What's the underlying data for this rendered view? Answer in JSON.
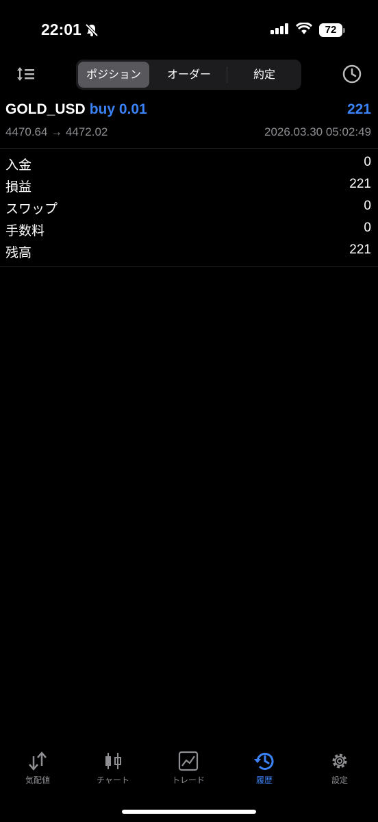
{
  "status_bar": {
    "time": "22:01",
    "battery": "72"
  },
  "tabs": [
    {
      "label": "ポジション",
      "active": true
    },
    {
      "label": "オーダー",
      "active": false
    },
    {
      "label": "約定",
      "active": false
    }
  ],
  "position": {
    "symbol": "GOLD_USD",
    "side": "buy 0.01",
    "profit": "221",
    "prices": "4470.64 → 4472.02",
    "datetime": "2026.03.30 05:02:49"
  },
  "summary": [
    {
      "label": "入金",
      "value": "0"
    },
    {
      "label": "損益",
      "value": "221"
    },
    {
      "label": "スワップ",
      "value": "0"
    },
    {
      "label": "手数料",
      "value": "0"
    },
    {
      "label": "残高",
      "value": "221"
    }
  ],
  "nav": [
    {
      "label": "気配値",
      "icon": "quotes-arrows-icon",
      "active": false
    },
    {
      "label": "チャート",
      "icon": "candlestick-icon",
      "active": false
    },
    {
      "label": "トレード",
      "icon": "trade-chart-icon",
      "active": false
    },
    {
      "label": "履歴",
      "icon": "history-icon",
      "active": true
    },
    {
      "label": "設定",
      "icon": "settings-gear-icon",
      "active": false
    }
  ],
  "colors": {
    "accent": "#3b82f6",
    "background": "#000000",
    "muted": "#8e8e93"
  }
}
